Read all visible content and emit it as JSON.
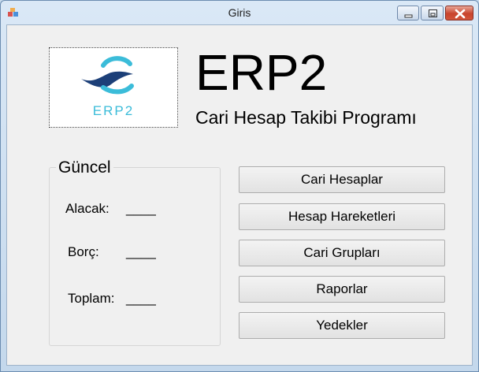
{
  "window": {
    "title": "Giris"
  },
  "logo": {
    "text": "ERP2"
  },
  "header": {
    "title": "ERP2",
    "subtitle": "Cari Hesap Takibi Programı"
  },
  "summary": {
    "title": "Güncel",
    "rows": [
      {
        "label": "Alacak:",
        "value": "____"
      },
      {
        "label": "Borç:",
        "value": "____"
      },
      {
        "label": "Toplam:",
        "value": "____"
      }
    ]
  },
  "buttons": [
    {
      "label": "Cari Hesaplar"
    },
    {
      "label": "Hesap Hareketleri"
    },
    {
      "label": "Cari Grupları"
    },
    {
      "label": "Raporlar"
    },
    {
      "label": "Yedekler"
    }
  ],
  "colors": {
    "logo_accent": "#3bbcd9",
    "logo_dark": "#1c3f78",
    "close_button": "#c8432c"
  },
  "icons": {
    "app": "app-icon",
    "minimize": "minimize-icon",
    "maximize": "maximize-icon",
    "close": "close-icon"
  }
}
